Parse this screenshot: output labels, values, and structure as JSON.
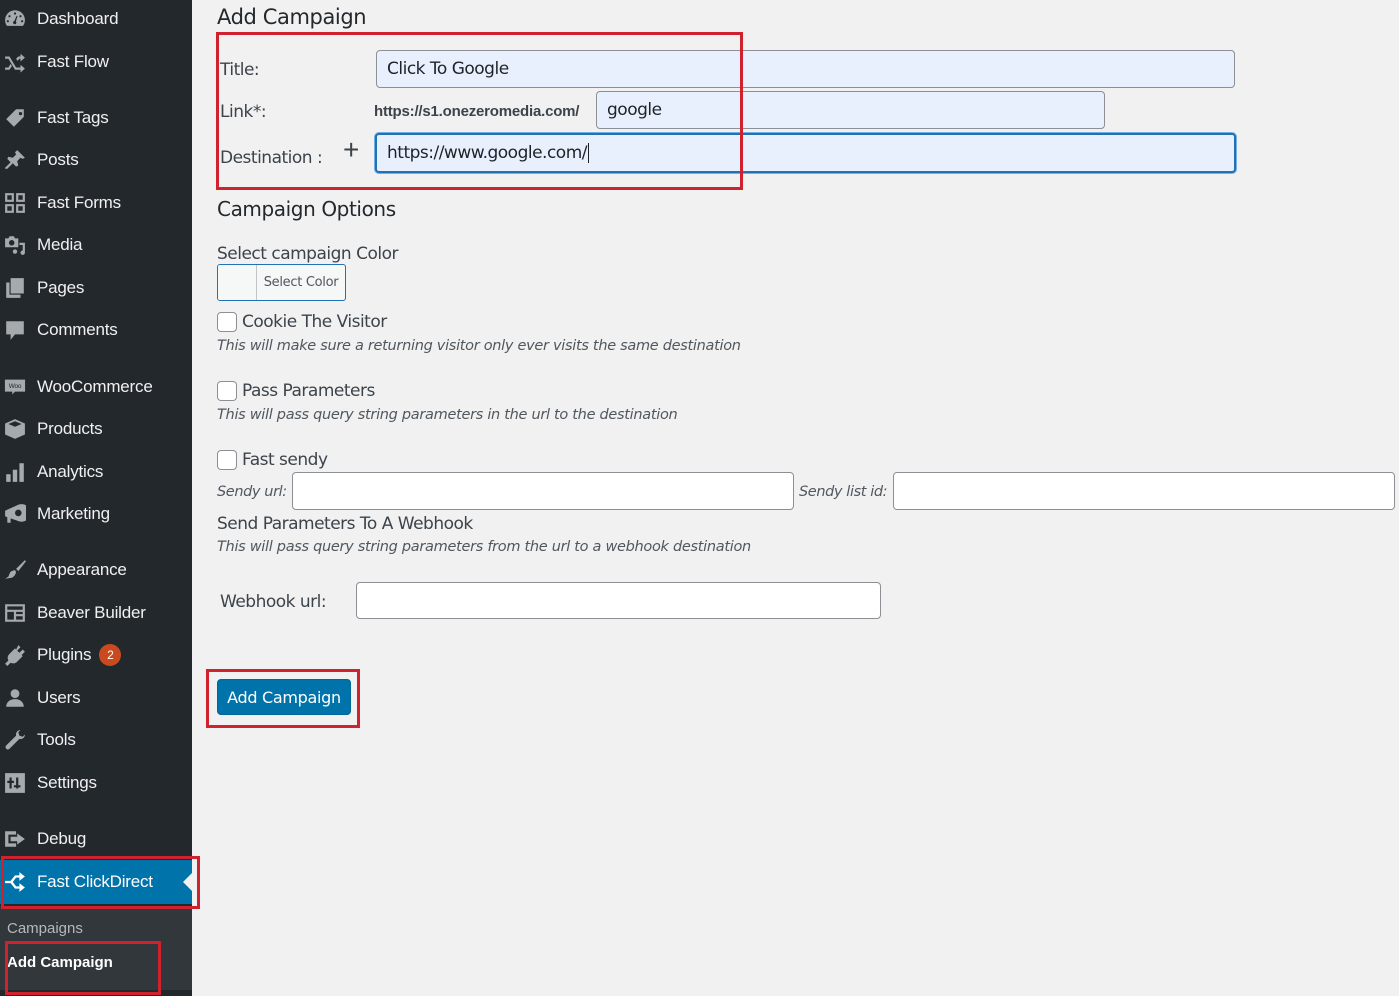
{
  "sidebar": {
    "items": [
      {
        "label": "Dashboard",
        "icon": "dashboard-icon"
      },
      {
        "label": "Fast Flow",
        "icon": "shuffle-icon"
      },
      {
        "label": "Fast Tags",
        "icon": "tag-icon"
      },
      {
        "label": "Posts",
        "icon": "pin-icon"
      },
      {
        "label": "Fast Forms",
        "icon": "forms-grid-icon"
      },
      {
        "label": "Media",
        "icon": "media-icon"
      },
      {
        "label": "Pages",
        "icon": "pages-icon"
      },
      {
        "label": "Comments",
        "icon": "comment-icon"
      },
      {
        "label": "WooCommerce",
        "icon": "woo-icon"
      },
      {
        "label": "Products",
        "icon": "box-icon"
      },
      {
        "label": "Analytics",
        "icon": "bar-chart-icon"
      },
      {
        "label": "Marketing",
        "icon": "megaphone-icon"
      },
      {
        "label": "Appearance",
        "icon": "paintbrush-icon"
      },
      {
        "label": "Beaver Builder",
        "icon": "layout-icon"
      },
      {
        "label": "Plugins",
        "icon": "plug-icon",
        "badge": "2"
      },
      {
        "label": "Users",
        "icon": "user-icon"
      },
      {
        "label": "Tools",
        "icon": "wrench-icon"
      },
      {
        "label": "Settings",
        "icon": "sliders-icon"
      },
      {
        "label": "Debug",
        "icon": "exit-icon"
      },
      {
        "label": "Fast ClickDirect",
        "icon": "redirect-icon",
        "active": true
      }
    ],
    "submenu": {
      "campaigns": "Campaigns",
      "add_campaign": "Add Campaign"
    }
  },
  "main": {
    "heading": "Add Campaign",
    "form": {
      "title_label": "Title:",
      "title_value": "Click To Google",
      "link_label": "Link*:",
      "link_prefix": "https://s1.onezeromedia.com/",
      "link_value": "google",
      "destination_label": "Destination :",
      "add_destination_symbol": "+",
      "destination_value": "https://www.google.com/"
    },
    "options": {
      "heading": "Campaign Options",
      "color_label": "Select campaign Color",
      "color_button": "Select Color",
      "cookie_label": "Cookie The Visitor",
      "cookie_checked": false,
      "cookie_desc": "This will make sure a returning visitor only ever visits the same destination",
      "pass_label": "Pass Parameters",
      "pass_checked": false,
      "pass_desc": "This will pass query string parameters in the url to the destination",
      "sendy_label": "Fast sendy",
      "sendy_checked": false,
      "sendy_url_label": "Sendy url:",
      "sendy_url_value": "",
      "sendy_list_label": "Sendy list id:",
      "sendy_list_value": "",
      "webhook_heading": "Send Parameters To A Webhook",
      "webhook_desc": "This will pass query string parameters from the url to a webhook destination",
      "webhook_label": "Webhook url:",
      "webhook_value": ""
    },
    "submit_label": "Add Campaign"
  },
  "colors": {
    "sidebar_bg": "#23282d",
    "active_bg": "#0073aa",
    "primary_button": "#0073aa",
    "badge": "#ca4a1f",
    "annotation": "#d0222e"
  }
}
